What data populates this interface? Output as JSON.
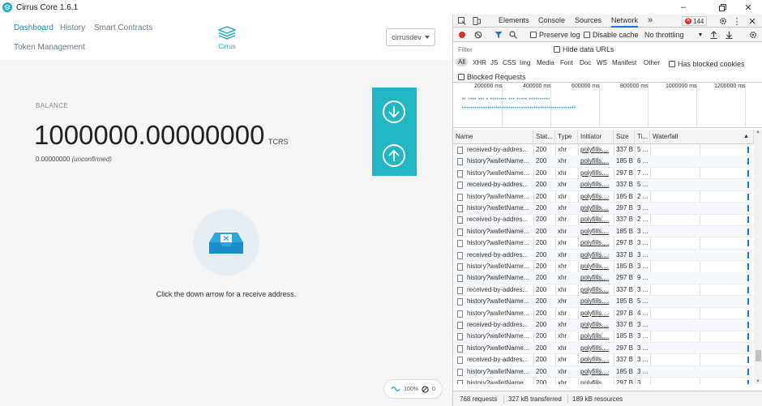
{
  "window": {
    "title": "Cirrus Core 1.6.1"
  },
  "nav": {
    "dashboard": "Dashboard",
    "history": "History",
    "smart_contracts": "Smart Contracts",
    "token_management": "Token Management"
  },
  "brand": {
    "name": "Cirrus"
  },
  "account": {
    "name": "cirrusdev"
  },
  "balance": {
    "label": "BALANCE",
    "value": "1000000.00000000",
    "unit": "TCRS",
    "unconfirmed_amount": "0.00000000",
    "unconfirmed_label": "(unconfirmed)"
  },
  "empty_state": {
    "message": "Click the down arrow for a receive address."
  },
  "status": {
    "sync_percent": "100%",
    "peers": "0"
  },
  "devtools": {
    "tabs": [
      "Elements",
      "Console",
      "Sources",
      "Network"
    ],
    "active_tab": "Network",
    "more_tabs": "»",
    "error_count": "144",
    "toolbar": {
      "preserve_log": "Preserve log",
      "disable_cache": "Disable cache",
      "throttling": "No throttling"
    },
    "filter": {
      "placeholder": "Filter",
      "hide_data_urls": "Hide data URLs"
    },
    "types": [
      "All",
      "XHR",
      "JS",
      "CSS",
      "Img",
      "Media",
      "Font",
      "Doc",
      "WS",
      "Manifest",
      "Other"
    ],
    "has_blocked_cookies": "Has blocked cookies",
    "blocked_requests": "Blocked Requests",
    "overview_ticks": [
      "200000 ms",
      "400000 ms",
      "600000 ms",
      "800000 ms",
      "1000000 ms",
      "1200000 ms"
    ],
    "columns": {
      "name": "Name",
      "status": "Stat...",
      "type": "Type",
      "initiator": "Initiator",
      "size": "Size",
      "time": "Ti...",
      "waterfall": "Waterfall"
    },
    "rows": [
      {
        "name": "received-by-addres...",
        "status": "200",
        "type": "xhr",
        "initiator": "polyfills....",
        "size": "337 B",
        "time": "5 ..."
      },
      {
        "name": "history?walletName...",
        "status": "200",
        "type": "xhr",
        "initiator": "polyfills....",
        "size": "185 B",
        "time": "6 ..."
      },
      {
        "name": "history?walletName...",
        "status": "200",
        "type": "xhr",
        "initiator": "polyfills....",
        "size": "297 B",
        "time": "7 ..."
      },
      {
        "name": "received-by-addres...",
        "status": "200",
        "type": "xhr",
        "initiator": "polyfills....",
        "size": "337 B",
        "time": "5 ..."
      },
      {
        "name": "history?walletName...",
        "status": "200",
        "type": "xhr",
        "initiator": "polyfills....",
        "size": "185 B",
        "time": "2 ..."
      },
      {
        "name": "history?walletName...",
        "status": "200",
        "type": "xhr",
        "initiator": "polyfills....",
        "size": "297 B",
        "time": "3 ..."
      },
      {
        "name": "received-by-addres...",
        "status": "200",
        "type": "xhr",
        "initiator": "polyfills....",
        "size": "337 B",
        "time": "2 ..."
      },
      {
        "name": "history?walletName...",
        "status": "200",
        "type": "xhr",
        "initiator": "polyfills....",
        "size": "185 B",
        "time": "3 ..."
      },
      {
        "name": "history?walletName...",
        "status": "200",
        "type": "xhr",
        "initiator": "polyfills....",
        "size": "297 B",
        "time": "3 ..."
      },
      {
        "name": "received-by-addres...",
        "status": "200",
        "type": "xhr",
        "initiator": "polyfills....",
        "size": "337 B",
        "time": "3 ..."
      },
      {
        "name": "history?walletName...",
        "status": "200",
        "type": "xhr",
        "initiator": "polyfills....",
        "size": "185 B",
        "time": "3 ..."
      },
      {
        "name": "history?walletName...",
        "status": "200",
        "type": "xhr",
        "initiator": "polyfills....",
        "size": "297 B",
        "time": "9 ..."
      },
      {
        "name": "received-by-addres...",
        "status": "200",
        "type": "xhr",
        "initiator": "polyfills....",
        "size": "337 B",
        "time": "3 ..."
      },
      {
        "name": "history?walletName...",
        "status": "200",
        "type": "xhr",
        "initiator": "polyfills....",
        "size": "185 B",
        "time": "5 ..."
      },
      {
        "name": "history?walletName...",
        "status": "200",
        "type": "xhr",
        "initiator": "polyfills....",
        "size": "297 B",
        "time": "4 ..."
      },
      {
        "name": "received-by-addres...",
        "status": "200",
        "type": "xhr",
        "initiator": "polyfills....",
        "size": "337 B",
        "time": "3 ..."
      },
      {
        "name": "history?walletName...",
        "status": "200",
        "type": "xhr",
        "initiator": "polyfills....",
        "size": "185 B",
        "time": "3 ..."
      },
      {
        "name": "history?walletName...",
        "status": "200",
        "type": "xhr",
        "initiator": "polyfills....",
        "size": "297 B",
        "time": "3 ..."
      },
      {
        "name": "received-by-addres...",
        "status": "200",
        "type": "xhr",
        "initiator": "polyfills....",
        "size": "337 B",
        "time": "3 ..."
      },
      {
        "name": "history?walletName...",
        "status": "200",
        "type": "xhr",
        "initiator": "polyfills....",
        "size": "185 B",
        "time": "3 ..."
      },
      {
        "name": "history?walletName...",
        "status": "200",
        "type": "xhr",
        "initiator": "polyfills....",
        "size": "297 B",
        "time": "3 ..."
      }
    ],
    "summary": {
      "requests": "768 requests",
      "transferred": "327 kB transferred",
      "resources": "189 kB resources"
    },
    "colors": {
      "accent": "#1a73e8",
      "record": "#d93025"
    }
  },
  "colors": {
    "primary": "#21b6c4",
    "nav_active": "#1c8fb0"
  }
}
